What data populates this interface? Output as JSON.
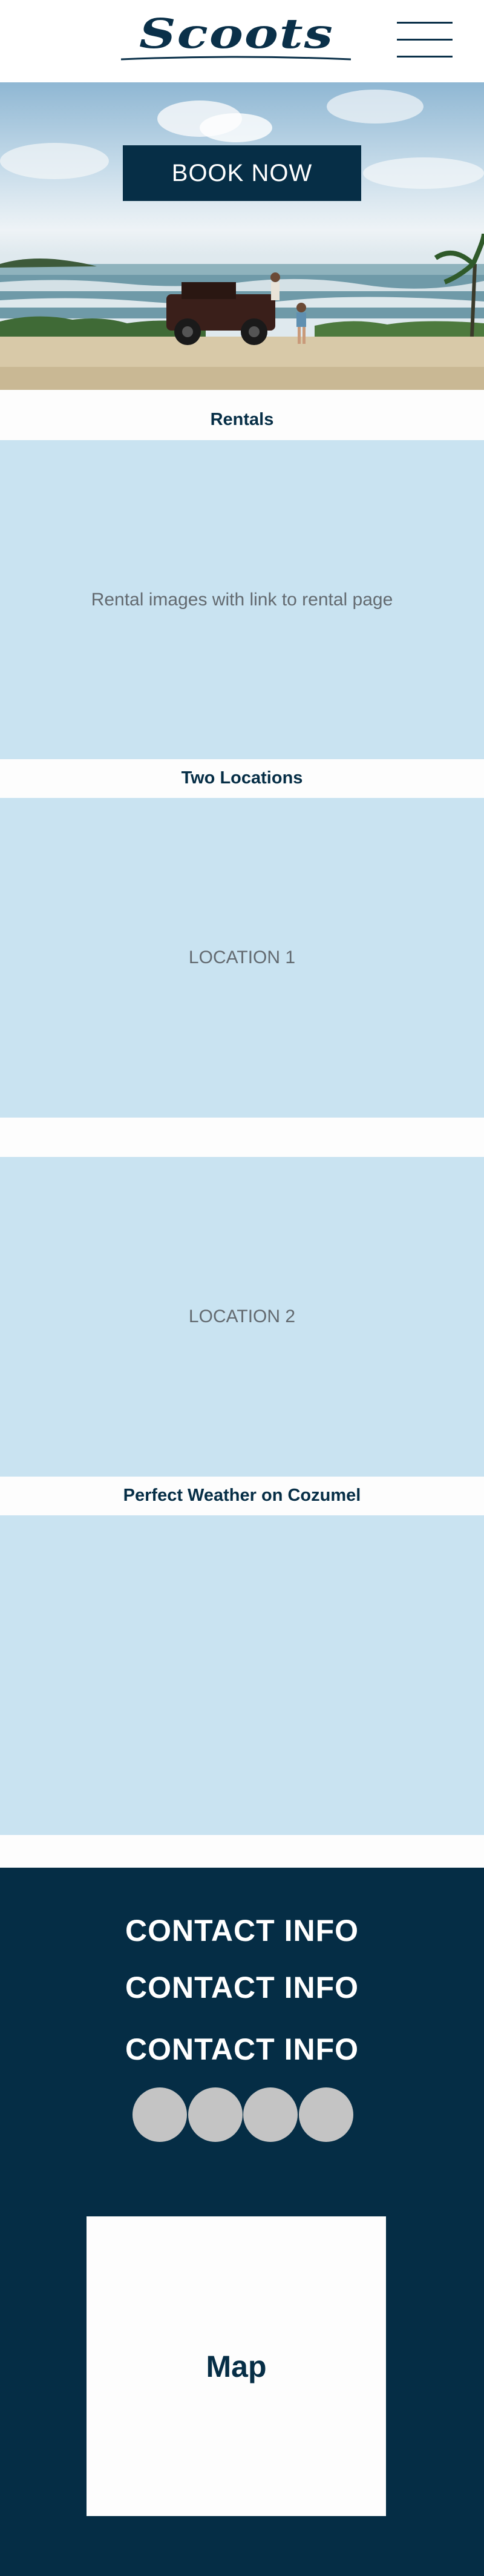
{
  "header": {
    "logo_text": "Scoots",
    "menu_icon": "hamburger-menu-icon"
  },
  "hero": {
    "book_button_label": "BOOK NOW"
  },
  "sections": {
    "rentals_title": "Rentals",
    "rentals_panel_text": "Rental images with link to rental page",
    "locations_title": "Two Locations",
    "location1_text": "LOCATION 1",
    "location2_text": "LOCATION 2",
    "weather_title": "Perfect Weather on Cozumel"
  },
  "footer": {
    "contact_lines": [
      "CONTACT INFO",
      "CONTACT INFO",
      "CONTACT INFO"
    ],
    "social_icons": [
      "social-icon-1",
      "social-icon-2",
      "social-icon-3",
      "social-icon-4"
    ],
    "map_label": "Map"
  },
  "colors": {
    "brand_navy": "#062e46",
    "panel_blue": "#c9e3f1",
    "social_gray": "#c4c4c4"
  }
}
